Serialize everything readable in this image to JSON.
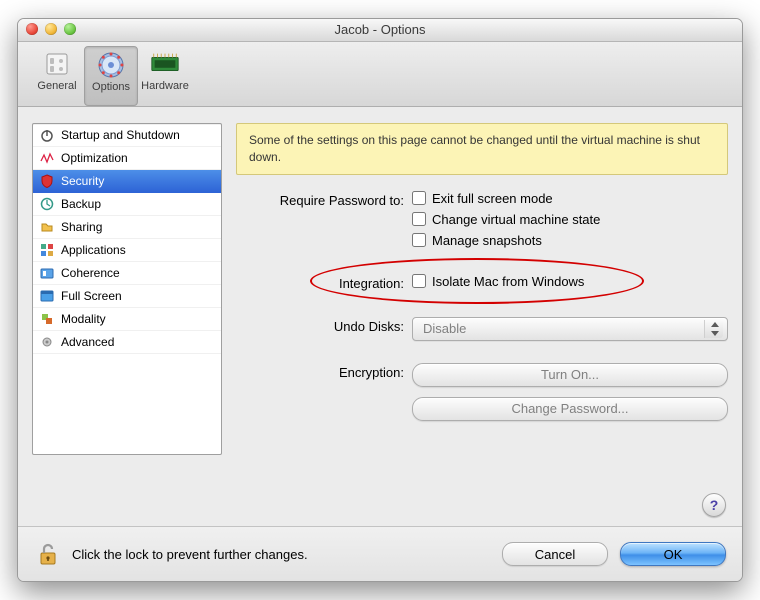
{
  "window": {
    "title": "Jacob - Options"
  },
  "toolbar": {
    "items": [
      {
        "label": "General"
      },
      {
        "label": "Options"
      },
      {
        "label": "Hardware"
      }
    ]
  },
  "sidebar": {
    "items": [
      {
        "label": "Startup and Shutdown"
      },
      {
        "label": "Optimization"
      },
      {
        "label": "Security"
      },
      {
        "label": "Backup"
      },
      {
        "label": "Sharing"
      },
      {
        "label": "Applications"
      },
      {
        "label": "Coherence"
      },
      {
        "label": "Full Screen"
      },
      {
        "label": "Modality"
      },
      {
        "label": "Advanced"
      }
    ]
  },
  "warning": "Some of the settings on this page cannot be changed until the virtual machine is shut down.",
  "security": {
    "require_password_label": "Require Password to:",
    "require_password_options": {
      "exit_full_screen": "Exit full screen mode",
      "change_state": "Change virtual machine state",
      "manage_snapshots": "Manage snapshots"
    },
    "integration_label": "Integration:",
    "integration_option": "Isolate Mac from Windows",
    "undo_disks_label": "Undo Disks:",
    "undo_disks_value": "Disable",
    "encryption_label": "Encryption:",
    "turn_on": "Turn On...",
    "change_password": "Change Password..."
  },
  "footer": {
    "lock_text": "Click the lock to prevent further changes.",
    "cancel": "Cancel",
    "ok": "OK"
  },
  "help": "?"
}
